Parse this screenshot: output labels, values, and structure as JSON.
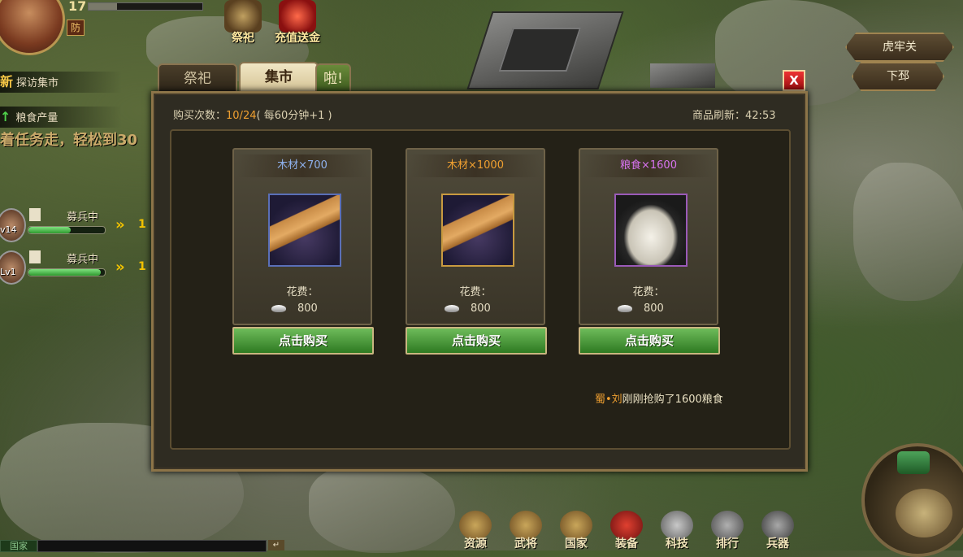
{
  "hud": {
    "level": "17",
    "exp_fraction": 0.25,
    "defense_badge": "防"
  },
  "top_icons": [
    {
      "label": "祭祀"
    },
    {
      "label": "充值送金"
    }
  ],
  "quests": [
    {
      "mark": "新",
      "text": "探访集市"
    },
    {
      "mark": "↑",
      "text": "粮食产量"
    }
  ],
  "scroll_tip": "着任务走，轻松到30",
  "troops": [
    {
      "level": "v14",
      "status": "募兵中",
      "progress": 0.55,
      "arrow": "»",
      "count": "1"
    },
    {
      "level": "Lv1",
      "status": "募兵中",
      "progress": 0.95,
      "arrow": "»",
      "count": "1"
    }
  ],
  "cities": [
    "虎牢关",
    "下邳"
  ],
  "panel": {
    "tabs": [
      "祭祀",
      "集市",
      "啦!"
    ],
    "active_tab": "集市",
    "close_label": "X",
    "buy_count_label": "购买次数：",
    "buy_count_value": "10/24",
    "buy_count_note": "( 每60分钟+1 )",
    "refresh_label": "商品刷新：",
    "refresh_time": "42:53",
    "cost_label": "花费：",
    "buy_button": "点击购买",
    "items": [
      {
        "title": "木材×700",
        "title_color": "#8fb2ee",
        "kind": "wood-icon",
        "cost": "800"
      },
      {
        "title": "木材×1000",
        "title_color": "#f0a030",
        "kind": "wood-icon",
        "cost": "800"
      },
      {
        "title": "粮食×1600",
        "title_color": "#d873f0",
        "kind": "grain-sack-icon",
        "cost": "800"
      }
    ],
    "ticker_name": "蜀•刘",
    "ticker_text": "刚刚抢购了1600粮食"
  },
  "bottom_menu": [
    "资源",
    "武将",
    "国家",
    "装备",
    "科技",
    "排行",
    "兵器"
  ],
  "chat": {
    "channel": "国家",
    "send": "↵"
  }
}
